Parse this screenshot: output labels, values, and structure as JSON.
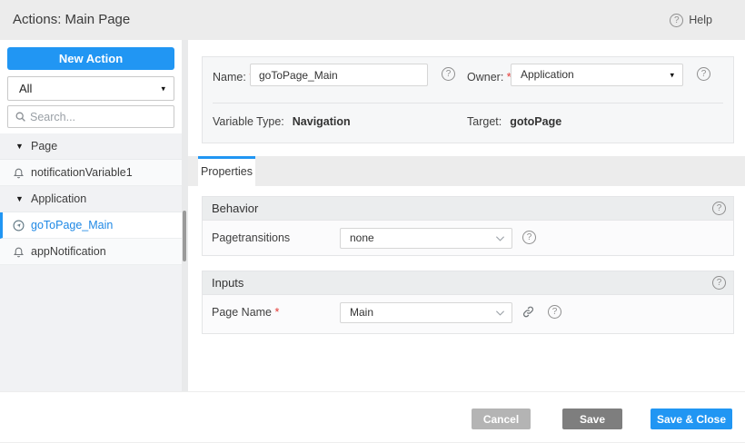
{
  "header": {
    "title": "Actions: Main Page",
    "help_label": "Help"
  },
  "sidebar": {
    "new_action_label": "New Action",
    "filter_value": "All",
    "search_placeholder": "Search...",
    "tree": [
      {
        "type": "group",
        "label": "Page",
        "expanded": true
      },
      {
        "type": "item",
        "label": "notificationVariable1",
        "icon": "bell-icon",
        "selected": false
      },
      {
        "type": "group",
        "label": "Application",
        "expanded": true
      },
      {
        "type": "item",
        "label": "goToPage_Main",
        "icon": "navigation-icon",
        "selected": true
      },
      {
        "type": "item",
        "label": "appNotification",
        "icon": "bell-icon",
        "selected": false
      }
    ]
  },
  "form": {
    "name_label": "Name:",
    "name_value": "goToPage_Main",
    "owner_label": "Owner:",
    "owner_value": "Application",
    "variable_type_label": "Variable Type:",
    "variable_type_value": "Navigation",
    "target_label": "Target:",
    "target_value": "gotoPage"
  },
  "tabs": [
    {
      "label": "Properties",
      "active": true
    }
  ],
  "sections": [
    {
      "title": "Behavior",
      "rows": [
        {
          "label": "Pagetransitions",
          "required": false,
          "value": "none",
          "has_link": false
        }
      ]
    },
    {
      "title": "Inputs",
      "rows": [
        {
          "label": "Page Name",
          "required": true,
          "value": "Main",
          "has_link": true
        }
      ]
    }
  ],
  "footer": {
    "cancel_label": "Cancel",
    "save_label": "Save",
    "save_close_label": "Save & Close"
  },
  "ui": {
    "required_mark": "*",
    "help_glyph": "?",
    "dropdown_arrow": "▾"
  },
  "colors": {
    "accent": "#2196f3",
    "selected_text": "#1e88e5",
    "required": "#e53935",
    "header_bg": "#ececec",
    "cancel_bg": "#b4b4b4",
    "save_bg": "#7e7e7e",
    "save_close_bg": "#2196f3"
  }
}
